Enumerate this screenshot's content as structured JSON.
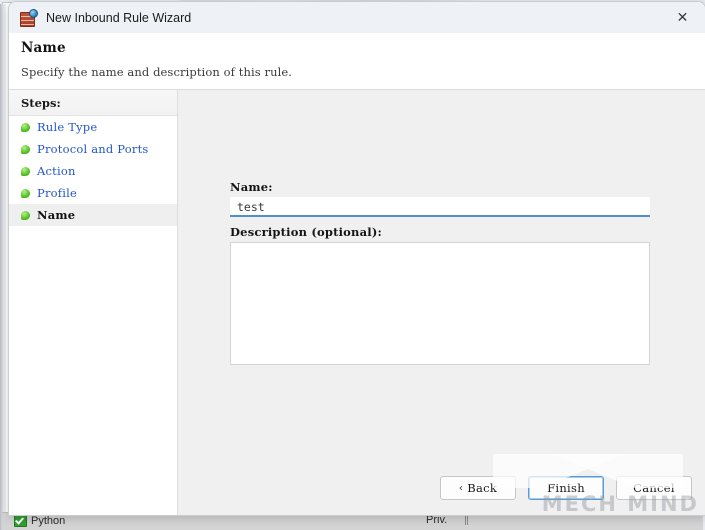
{
  "background": {
    "statusbar": {
      "app_label": "Python",
      "app_icon": "green-check-icon",
      "column_label": "Priv."
    }
  },
  "watermark": {
    "text": "MECH MIND"
  },
  "dialog": {
    "titlebar": {
      "icon": "firewall-shield-icon",
      "title": "New Inbound Rule Wizard",
      "close_label": "✕"
    },
    "header": {
      "title": "Name",
      "subtitle": "Specify the name and description of this rule."
    },
    "sidebar": {
      "heading": "Steps:",
      "items": [
        {
          "label": "Rule Type",
          "state": "completed"
        },
        {
          "label": "Protocol and Ports",
          "state": "completed"
        },
        {
          "label": "Action",
          "state": "completed"
        },
        {
          "label": "Profile",
          "state": "completed"
        },
        {
          "label": "Name",
          "state": "current"
        }
      ]
    },
    "content": {
      "name_label": "Name:",
      "name_value": "test",
      "name_placeholder": "",
      "description_label": "Description (optional):",
      "description_value": "",
      "description_placeholder": ""
    },
    "footer": {
      "back_label": "Back",
      "back_chevron": "‹",
      "finish_label": "Finish",
      "cancel_label": "Cancel"
    }
  },
  "colors": {
    "accent_blue": "#4f8fd0",
    "link_blue": "#2255cc",
    "step_dot_green": "#4fbf1f",
    "panel_gray": "#f0f0f0",
    "titlebar": "#eef2f7"
  }
}
